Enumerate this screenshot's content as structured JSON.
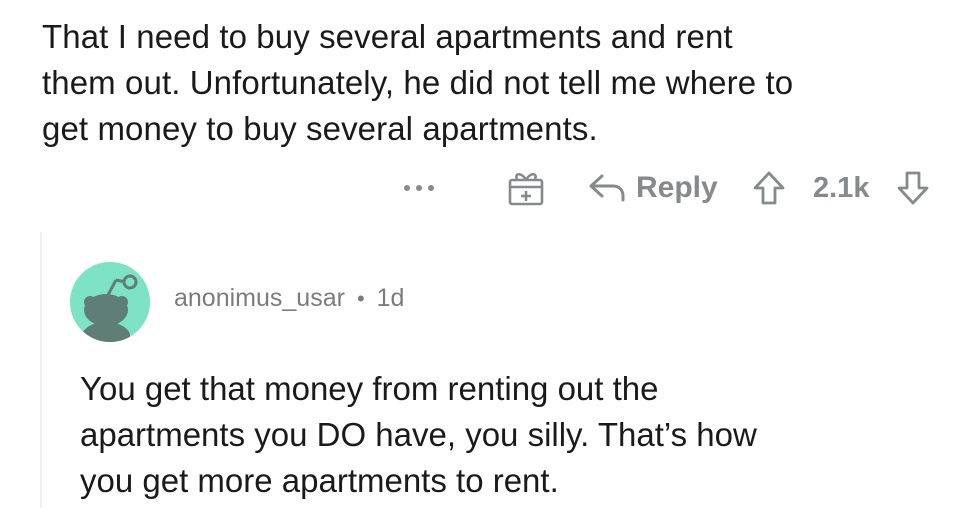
{
  "parent_comment": {
    "lines": [
      "That I need to buy several apartments and rent",
      "them out. Unfortunately, he did not tell me where to",
      "get money to buy several apartments."
    ]
  },
  "actions": {
    "more_icon": "ellipsis-icon",
    "award_icon": "gift-icon",
    "reply_icon": "reply-arrow-icon",
    "reply_label": "Reply",
    "upvote_icon": "arrow-up-icon",
    "score": "2.1k",
    "downvote_icon": "arrow-down-icon"
  },
  "reply_comment": {
    "avatar_icon": "reddit-snoo-avatar-icon",
    "username": "anonimus_usar",
    "separator": "•",
    "age": "1d",
    "lines": [
      "You get that money from renting out the",
      "apartments you DO have, you silly. That’s how",
      "you get more apartments to rent."
    ]
  },
  "colors": {
    "text": "#1a1a1b",
    "muted": "#878a8c",
    "avatar_bg": "#7de3c4",
    "thread_line": "#edeff1"
  }
}
